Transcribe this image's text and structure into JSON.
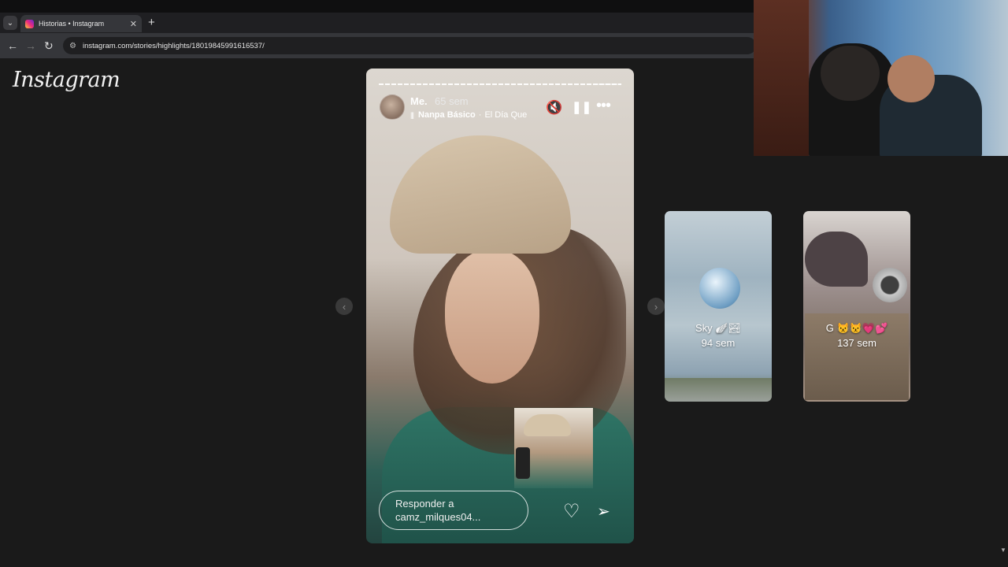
{
  "browser": {
    "tab_title": "Historias • Instagram",
    "tab_list_icon": "⌄",
    "new_tab_icon": "+",
    "close_icon": "✕",
    "back_icon": "←",
    "forward_icon": "→",
    "reload_icon": "↻",
    "site_info_icon": "⚙",
    "url": "instagram.com/stories/highlights/18019845991616537/"
  },
  "page": {
    "logo": "Instagram",
    "prev_icon": "‹",
    "next_icon": "›"
  },
  "story": {
    "username": "Me.",
    "time": "65 sem",
    "music_bars": "|||",
    "song": "Nanpa Básico",
    "separator": "·",
    "artist": "El Día Que",
    "mute_icon": "🔇",
    "pause_icon": "❚❚",
    "more_icon": "•••",
    "reply_line1": "Responder a",
    "reply_line2": "camz_milques04...",
    "like_icon": "♡",
    "share_icon": "➢"
  },
  "highlights": [
    {
      "title": "Sky",
      "emoji": "🪽🏞",
      "time": "94 sem"
    },
    {
      "title": "G",
      "emoji": "😾😾💗💕",
      "time": "137 sem"
    }
  ],
  "scroll_arrow": "▼",
  "colors": {
    "page_bg": "#1a1a1a",
    "toolbar": "#35363a"
  }
}
